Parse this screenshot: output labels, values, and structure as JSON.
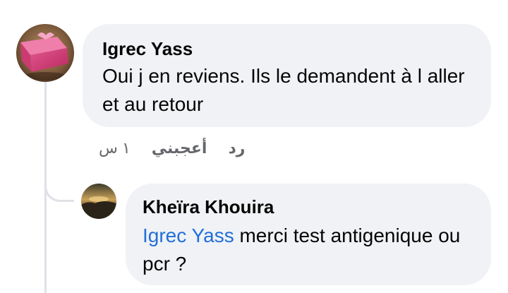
{
  "comment": {
    "author": "Igrec Yass",
    "text": "Oui j en reviens. Ils le demandent à l aller et au retour",
    "actions": {
      "reply_label": "رد",
      "like_label": "أعجبني",
      "timestamp": "١ س"
    }
  },
  "reply": {
    "author": "Kheïra Khouira",
    "mention": "Igrec Yass",
    "text": " merci test antigenique ou pcr ?"
  },
  "colors": {
    "bubble_bg": "#f0f2f5",
    "mention": "#216fdb",
    "meta_text": "#65676b",
    "thread_line": "#dfe1e6"
  }
}
